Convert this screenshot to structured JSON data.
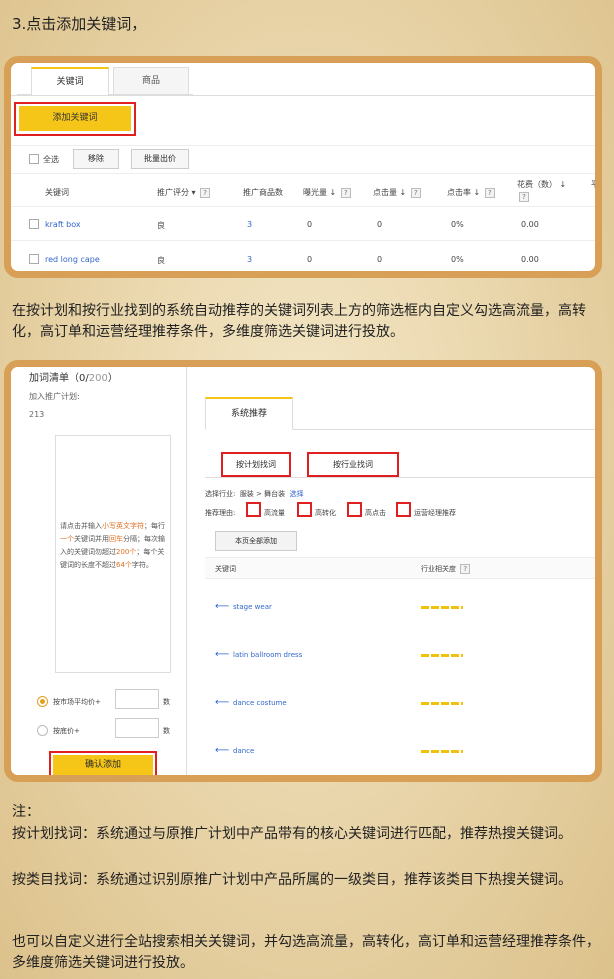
{
  "step_title": "3.点击添加关键词，",
  "panel1": {
    "tabs": [
      "关键词",
      "商品"
    ],
    "add_button": "添加关键词",
    "select_all": "全选",
    "remove": "移除",
    "bulk_bid": "批量出价",
    "columns": [
      "关键词",
      "推广评分",
      "推广商品数",
      "曝光量",
      "点击量",
      "点击率",
      "花费（数）",
      "平"
    ],
    "rows": [
      {
        "keyword": "kraft box",
        "score": "良",
        "products": "3",
        "impressions": "0",
        "clicks": "0",
        "ctr": "0%",
        "cost": "0.00"
      },
      {
        "keyword": "red long cape",
        "score": "良",
        "products": "3",
        "impressions": "0",
        "clicks": "0",
        "ctr": "0%",
        "cost": "0.00"
      }
    ]
  },
  "para1": "在按计划和按行业找到的系统自动推荐的关键词列表上方的筛选框内自定义勾选高流量，高转化，高订单和运营经理推荐条件，多维度筛选关键词进行投放。",
  "panel2": {
    "list_title": "加词清单（0/",
    "list_count": "200",
    "list_close": "）",
    "plan_label": "加入推广计划:",
    "plan_id": "213",
    "hint": [
      "请点击并输入",
      "小写英文字符",
      "；每行",
      "一个",
      "关键词并用",
      "回车",
      "分隔；每次输入的关键词勿超过",
      "200个",
      "；每个关键词的长度不超过",
      "64个",
      "字符。"
    ],
    "price_opt1": "按市场平均价+",
    "price_opt2": "按底价+",
    "unit": "数",
    "confirm": "确认添加",
    "sys_tab": "系统推荐",
    "by_plan": "按计划找词",
    "by_industry": "按行业找词",
    "industry_label": "选择行业:",
    "industry_path": "服装 > 舞台装",
    "industry_choose": "选择",
    "reason_label": "推荐理由:",
    "reasons": [
      "高流量",
      "高转化",
      "高点击",
      "运营经理推荐"
    ],
    "add_all": "本页全部添加",
    "col_keyword": "关键词",
    "col_relevance": "行业相关度",
    "keywords": [
      "stage wear",
      "latin ballroom dress",
      "dance costume",
      "dance"
    ]
  },
  "notes": {
    "heading": "注：",
    "plan_note": "按计划找词：系统通过与原推广计划中产品带有的核心关键词进行匹配，推荐热搜关键词。",
    "category_note": "按类目找词：系统通过识别原推广计划中产品所属的一级类目，推荐该类目下热搜关键词。",
    "custom_note": "也可以自定义进行全站搜索相关关键词，并勾选高流量，高转化，高订单和运营经理推荐条件，多维度筛选关键词进行投放。"
  }
}
